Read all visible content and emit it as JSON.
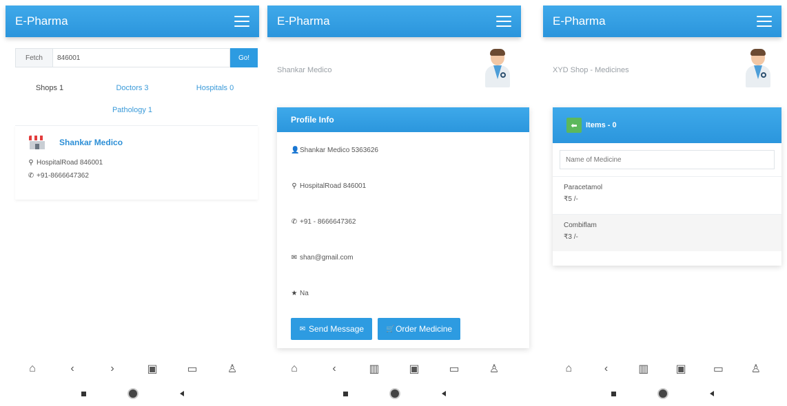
{
  "app": {
    "title": "E-Pharma"
  },
  "screen1": {
    "fetch_label": "Fetch",
    "fetch_value": "846001",
    "go_label": "Go!",
    "tabs": [
      "Shops 1",
      "Doctors 3",
      "Hospitals 0",
      "Pathology 1"
    ],
    "shop": {
      "name": "Shankar Medico",
      "address": "HospitalRoad 846001",
      "phone": "+91-8666647362"
    }
  },
  "screen2": {
    "shop_title": "Shankar Medico",
    "card_title": "Profile Info",
    "rows": [
      "Shankar Medico 5363626",
      "HospitalRoad 846001",
      "+91 - 8666647362",
      "shan@gmail.com",
      "Na"
    ],
    "send_label": "Send Message",
    "order_label": "Order Medicine"
  },
  "screen3": {
    "shop_title": "XYD Shop - Medicines",
    "items_label": "Items - 0",
    "search_placeholder": "Name of Medicine",
    "items": [
      {
        "name": "Paracetamol",
        "price": "₹5 /-"
      },
      {
        "name": "Combiflam",
        "price": "₹3 /-"
      }
    ]
  }
}
